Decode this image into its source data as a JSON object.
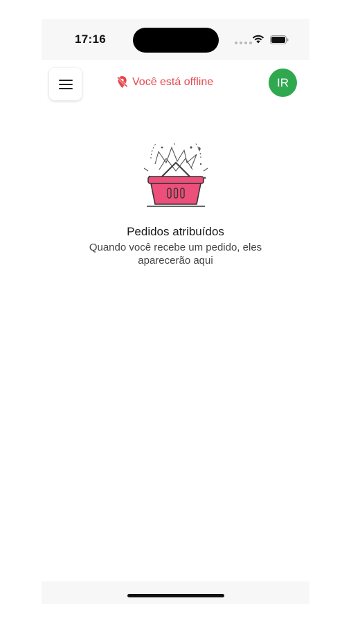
{
  "status_bar": {
    "time": "17:16",
    "wifi_icon": "wifi-icon",
    "battery_icon": "battery-icon"
  },
  "header": {
    "menu_icon": "hamburger-menu-icon",
    "offline_text": "Você está offline",
    "offline_icon": "location-off-icon",
    "avatar_initials": "IR",
    "avatar_color": "#2fa84f",
    "offline_color": "#e5484d"
  },
  "empty_state": {
    "illustration": "shopping-basket-icon",
    "title": "Pedidos atribuídos",
    "description": "Quando você recebe um pedido, eles aparecerão aqui",
    "basket_color": "#ec4f7a"
  }
}
